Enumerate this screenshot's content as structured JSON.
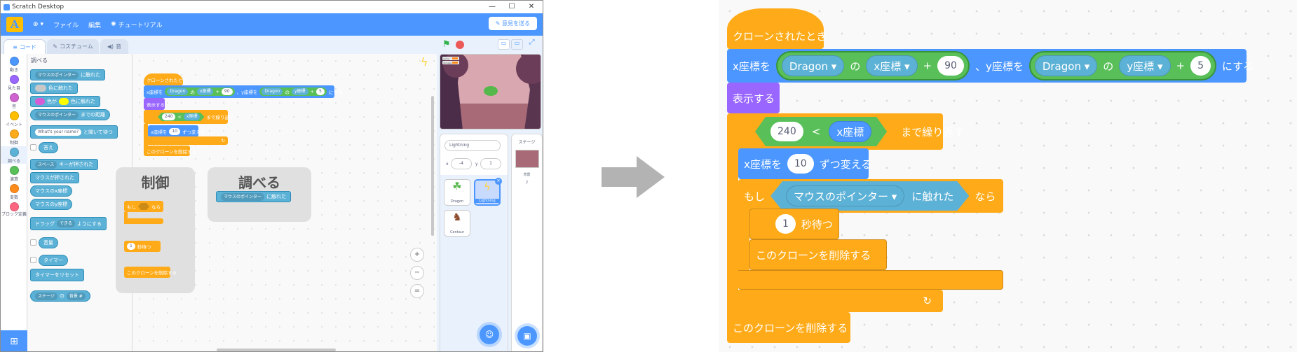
{
  "window": {
    "title": "Scratch Desktop",
    "menu": {
      "file": "ファイル",
      "edit": "編集",
      "tutorials": "チュートリアル",
      "feedback": "意見を送る"
    },
    "tabs": {
      "code": "コード",
      "costumes": "コスチューム",
      "sounds": "音"
    }
  },
  "categories": [
    {
      "label": "動き",
      "color": "#4c97ff"
    },
    {
      "label": "見た目",
      "color": "#9966ff"
    },
    {
      "label": "音",
      "color": "#cf63cf"
    },
    {
      "label": "イベント",
      "color": "#ffbf00"
    },
    {
      "label": "制御",
      "color": "#ffab19"
    },
    {
      "label": "調べる",
      "color": "#5cb1d6"
    },
    {
      "label": "演算",
      "color": "#59c059"
    },
    {
      "label": "変数",
      "color": "#ff8c1a"
    },
    {
      "label": "ブロック定義",
      "color": "#ff6680"
    }
  ],
  "palette": {
    "heading": "調べる",
    "touching_dd": "マウスのポインター",
    "touching": "に触れた",
    "color_touching": "色に触れた",
    "color_is": "色が",
    "color_is2": "色に触れた",
    "distance_dd": "マウスのポインター",
    "distance": "までの距離",
    "ask_default": "What's your name?",
    "ask_wait": "と聞いて待つ",
    "answer": "答え",
    "key_dd": "スペース",
    "key_pressed": "キーが押された",
    "mouse_down": "マウスが押された",
    "mouse_x": "マウスのx座標",
    "mouse_y": "マウスのy座標",
    "drag": "ドラッグ",
    "drag_dd": "できる",
    "drag_suffix": "ようにする",
    "loudness": "音量",
    "timer": "タイマー",
    "reset_timer": "タイマーをリセット",
    "of_dd": "ステージ",
    "of": "の",
    "backdrop_dd": "背景 #"
  },
  "script": {
    "hat": "クローンされたとき",
    "goto_x": "x座標を",
    "sprite1": "Dragon",
    "of": "の",
    "xprop": "x座標",
    "plus": "+",
    "n90": "90",
    "goto_y": "、y座標を",
    "yprop": "y座標",
    "n5": "5",
    "set_suffix": "にする",
    "show": "表示する",
    "n240": "240",
    "lt": "<",
    "xpos": "x座標",
    "repeat_until": "まで繰り返す",
    "change_x": "x座標を",
    "n10": "10",
    "change_suffix": "ずつ変える",
    "if": "もし",
    "touch_dd": "マウスのポインター",
    "touching": "に触れた",
    "then": "なら",
    "n1": "1",
    "wait": "秒待つ",
    "delete_clone": "このクローンを削除する",
    "loop_arrow": "↻"
  },
  "cards": {
    "control_title": "制御",
    "control_if": "もし",
    "control_then": "なら",
    "control_wait_n": "1",
    "control_wait": "秒待つ",
    "control_delete": "このクローンを削除する",
    "sensing_title": "調べる",
    "sensing_dd": "マウスのポインター",
    "sensing_touch": "に触れた"
  },
  "zoom_controls": {
    "zoom_in": "+",
    "zoom_out": "−",
    "reset": "="
  },
  "sprite_info": {
    "name": "Lightning",
    "x_label": "x",
    "x": "-4",
    "y_label": "y",
    "y": "1"
  },
  "sprites": [
    "Dragon",
    "Lightning",
    "Centaur"
  ],
  "stage_panel": {
    "title": "ステージ",
    "backdrops_label": "背景",
    "backdrops_count": "2"
  },
  "stage_monitors": [
    "sprite",
    "damage"
  ],
  "colors": {
    "scratch_blue": "#4c97ff",
    "control": "#ffab19",
    "looks": "#9966ff",
    "sensing": "#5cb1d6",
    "operators": "#59c059"
  }
}
